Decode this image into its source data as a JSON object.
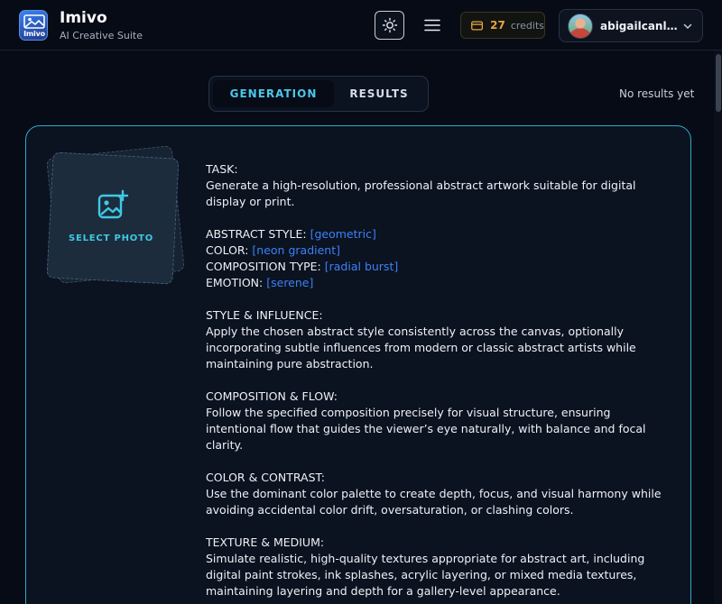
{
  "header": {
    "logo_text": "Imivo",
    "brand_name": "Imivo",
    "brand_subtitle": "AI Creative Suite",
    "theme_icon": "sun-icon",
    "menu_icon": "hamburger-menu-icon",
    "credits": {
      "icon": "credit-card-icon",
      "count": "27",
      "label": "credits"
    },
    "user": {
      "name": "abigailcanlas...",
      "chevron_icon": "chevron-down-icon"
    }
  },
  "tabs": [
    {
      "label": "GENERATION",
      "active": true
    },
    {
      "label": "RESULTS",
      "active": false
    }
  ],
  "results_status": "No results yet",
  "upload": {
    "icon": "image-add-icon",
    "label": "SELECT PHOTO"
  },
  "prompt": {
    "task_heading": "TASK:",
    "task_text": "Generate a high-resolution, professional abstract artwork suitable for digital display or print.",
    "abstract_style_label": "ABSTRACT STYLE:",
    "abstract_style_value": "[geometric]",
    "color_label": "COLOR:",
    "color_value": "[neon gradient]",
    "composition_type_label": "COMPOSITION TYPE:",
    "composition_type_value": "[radial burst]",
    "emotion_label": "EMOTION:",
    "emotion_value": "[serene]",
    "style_heading": "STYLE & INFLUENCE:",
    "style_text": "Apply the chosen abstract style consistently across the canvas, optionally incorporating subtle influences from modern or classic abstract artists while maintaining pure abstraction.",
    "composition_heading": "COMPOSITION & FLOW:",
    "composition_text": "Follow the specified composition precisely for visual structure, ensuring intentional flow that guides the viewer’s eye naturally, with balance and focal clarity.",
    "contrast_heading": "COLOR & CONTRAST:",
    "contrast_text": "Use the dominant color palette to create depth, focus, and visual harmony while avoiding accidental color drift, oversaturation, or clashing colors.",
    "texture_heading": "TEXTURE & MEDIUM:",
    "texture_text": "Simulate realistic, high-quality textures appropriate for abstract art, including digital paint strokes, ink splashes, acrylic layering, or mixed media textures, maintaining layering and depth for a gallery-level appearance."
  },
  "colors": {
    "accent": "#4cc7e8",
    "value_blue": "#3b82f6",
    "credits_orange": "#e8a43a",
    "background": "#060b16"
  }
}
